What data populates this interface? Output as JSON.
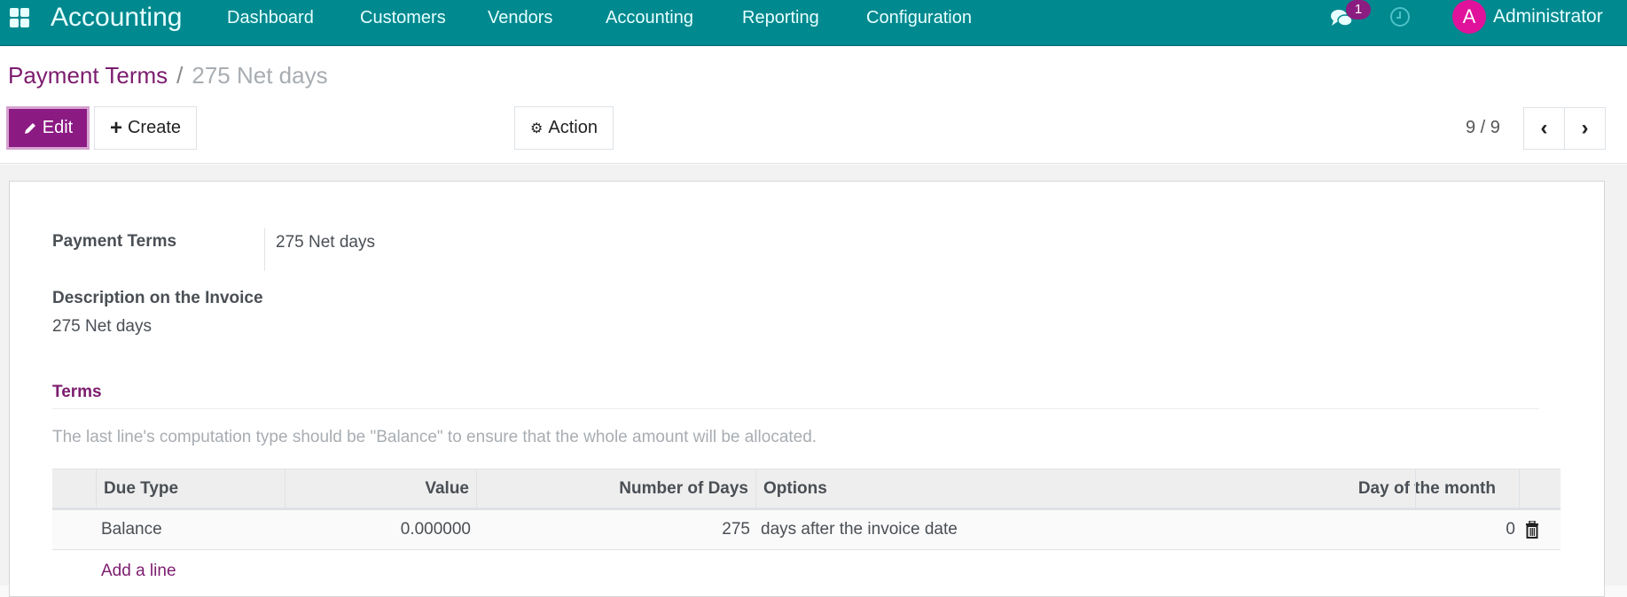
{
  "navbar": {
    "app_title": "Accounting",
    "menu": [
      "Dashboard",
      "Customers",
      "Vendors",
      "Accounting",
      "Reporting",
      "Configuration"
    ],
    "message_count": "1",
    "avatar_letter": "A",
    "user": "Administrator"
  },
  "breadcrumb": {
    "parent": "Payment Terms",
    "separator": "/",
    "current": "275 Net days"
  },
  "toolbar": {
    "edit_label": "Edit",
    "create_label": "Create",
    "action_label": "Action",
    "pager": "9 / 9"
  },
  "form": {
    "payment_terms_label": "Payment Terms",
    "payment_terms_value": "275 Net days",
    "description_label": "Description on the Invoice",
    "description_value": "275 Net days",
    "terms_section": "Terms",
    "help_text": "The last line's computation type should be \"Balance\" to ensure that the whole amount will be allocated."
  },
  "table": {
    "headers": [
      "Due Type",
      "Value",
      "Number of Days",
      "Options",
      "Day of the month"
    ],
    "rows": [
      {
        "due_type": "Balance",
        "value": "0.000000",
        "days": "275",
        "options": "days after the invoice date",
        "day_of_month": "0"
      }
    ],
    "add_line": "Add a line"
  },
  "colors": {
    "navbar": "#00898f",
    "primary": "#8b1a83",
    "link": "#7c1c6e"
  }
}
